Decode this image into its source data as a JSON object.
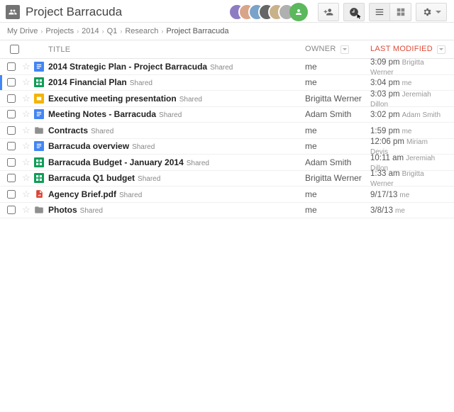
{
  "header": {
    "title": "Project Barracuda",
    "collaborators": [
      {
        "bg": "#8e7cc3"
      },
      {
        "bg": "#d9a58a"
      },
      {
        "bg": "#7aa3c9"
      },
      {
        "bg": "#666666"
      },
      {
        "bg": "#c9b18a"
      },
      {
        "bg": "#b0b0b0"
      }
    ],
    "presence_color": "#5cb85c"
  },
  "breadcrumbs": [
    {
      "label": "My Drive"
    },
    {
      "label": "Projects"
    },
    {
      "label": "2014"
    },
    {
      "label": "Q1"
    },
    {
      "label": "Research"
    },
    {
      "label": "Project Barracuda",
      "current": true
    }
  ],
  "columns": {
    "title": "TITLE",
    "owner": "OWNER",
    "modified": "LAST MODIFIED"
  },
  "shared_label": "Shared",
  "files": [
    {
      "icon": "doc",
      "title": "2014 Strategic Plan - Project Barracuda",
      "shared": true,
      "owner": "me",
      "time": "3:09 pm",
      "by": "Brigitta Werner",
      "active": false
    },
    {
      "icon": "sheet",
      "title": "2014 Financial Plan",
      "shared": true,
      "owner": "me",
      "time": "3:04 pm",
      "by": "me",
      "active": true
    },
    {
      "icon": "slides",
      "title": "Executive meeting presentation",
      "shared": true,
      "owner": "Brigitta Werner",
      "time": "3:03 pm",
      "by": "Jeremiah Dillon",
      "active": false
    },
    {
      "icon": "doc",
      "title": "Meeting Notes - Barracuda",
      "shared": true,
      "owner": "Adam Smith",
      "time": "3:02 pm",
      "by": "Adam Smith",
      "active": false
    },
    {
      "icon": "folder",
      "title": "Contracts",
      "shared": true,
      "owner": "me",
      "time": "1:59 pm",
      "by": "me",
      "active": false
    },
    {
      "icon": "doc",
      "title": "Barracuda overview",
      "shared": true,
      "owner": "me",
      "time": "12:06 pm",
      "by": "Miriam Devis",
      "active": false
    },
    {
      "icon": "sheet",
      "title": "Barracuda Budget - January 2014",
      "shared": true,
      "owner": "Adam Smith",
      "time": "10:11 am",
      "by": "Jeremiah Dillon",
      "active": false
    },
    {
      "icon": "sheet",
      "title": "Barracuda Q1 budget",
      "shared": true,
      "owner": "Brigitta Werner",
      "time": "1:33 am",
      "by": "Brigitta Werner",
      "active": false
    },
    {
      "icon": "pdf",
      "title": "Agency Brief.pdf",
      "shared": true,
      "owner": "me",
      "time": "9/17/13",
      "by": "me",
      "active": false
    },
    {
      "icon": "folder",
      "title": "Photos",
      "shared": true,
      "owner": "me",
      "time": "3/8/13",
      "by": "me",
      "active": false
    }
  ]
}
